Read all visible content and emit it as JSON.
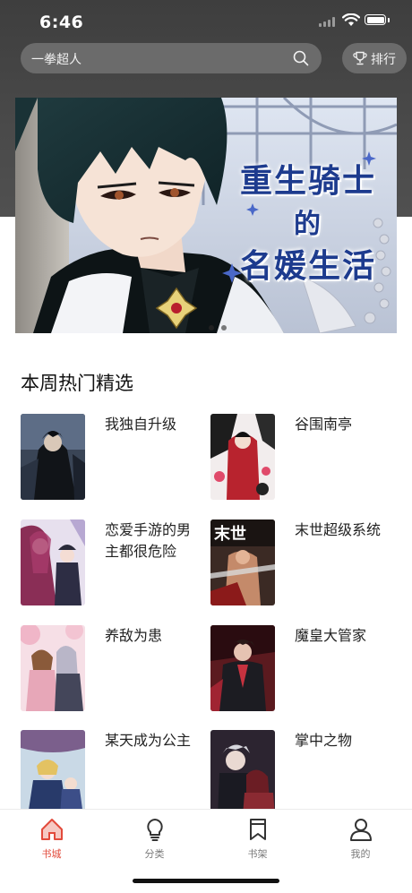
{
  "status_bar": {
    "time": "6:46"
  },
  "search": {
    "placeholder": "一拳超人",
    "icon": "search-icon"
  },
  "rank_button": {
    "label": "排行",
    "icon": "trophy-icon"
  },
  "banner": {
    "title_line1": "重生骑士",
    "title_line2": "的",
    "title_line3": "名媛生活",
    "dots": 2,
    "active_dot": 0
  },
  "section": {
    "title": "本周热门精选"
  },
  "comics": [
    {
      "title": "我独自升级"
    },
    {
      "title": "谷围南亭"
    },
    {
      "title": "恋爱手游的男主都很危险"
    },
    {
      "title": "末世超级系统",
      "cover_text": "末世"
    },
    {
      "title": "养敌为患"
    },
    {
      "title": "魔皇大管家"
    },
    {
      "title": "某天成为公主"
    },
    {
      "title": "掌中之物"
    }
  ],
  "tabs": [
    {
      "label": "书城",
      "icon": "home-icon",
      "active": true
    },
    {
      "label": "分类",
      "icon": "lightbulb-icon",
      "active": false
    },
    {
      "label": "书架",
      "icon": "bookmark-icon",
      "active": false
    },
    {
      "label": "我的",
      "icon": "user-icon",
      "active": false
    }
  ],
  "colors": {
    "accent": "#e24a3b",
    "header_bg": "#444444",
    "banner_title": "#1d3b8e"
  }
}
